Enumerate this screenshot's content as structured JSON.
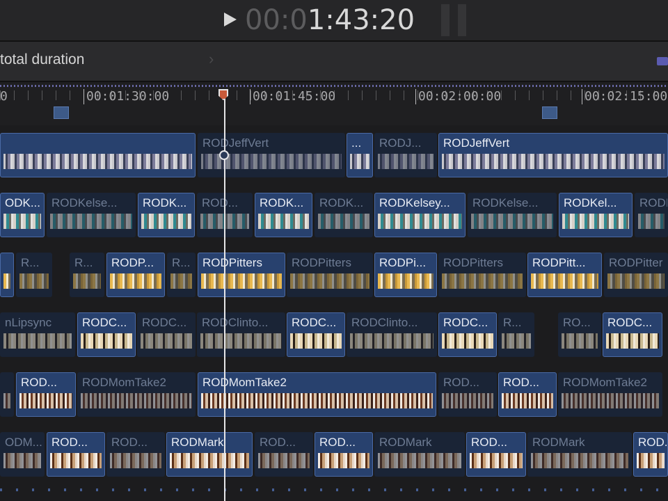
{
  "transport": {
    "timecode_dim": "00:0",
    "timecode_bright": "1:43:20",
    "play_icon": "play-icon"
  },
  "info": {
    "duration_label": "total duration",
    "chevron_icon": "chevron-right-icon"
  },
  "ruler": {
    "labels": [
      "0",
      "00:01:30:00",
      "00:01:45:00",
      "00:02:00:00",
      "00:02:15:00"
    ]
  },
  "tracks": [
    [
      {
        "name": "",
        "sel": true,
        "start": 0,
        "width": 281
      },
      {
        "name": "RODJeffVert",
        "sel": false,
        "start": 284,
        "width": 212
      },
      {
        "name": "...",
        "sel": true,
        "start": 498,
        "width": 38
      },
      {
        "name": "RODJ...",
        "sel": false,
        "start": 538,
        "width": 90
      },
      {
        "name": "RODJeffVert",
        "sel": true,
        "start": 630,
        "width": 330
      }
    ],
    [
      {
        "name": "ODK...",
        "sel": true,
        "start": 0,
        "width": 64
      },
      {
        "name": "RODKelse...",
        "sel": false,
        "start": 67,
        "width": 128
      },
      {
        "name": "RODK...",
        "sel": true,
        "start": 198,
        "width": 82
      },
      {
        "name": "ROD...",
        "sel": false,
        "start": 283,
        "width": 80
      },
      {
        "name": "RODK...",
        "sel": true,
        "start": 366,
        "width": 83
      },
      {
        "name": "RODK...",
        "sel": false,
        "start": 452,
        "width": 84
      },
      {
        "name": "RODKelsey...",
        "sel": true,
        "start": 538,
        "width": 131
      },
      {
        "name": "RODKelse...",
        "sel": false,
        "start": 672,
        "width": 128
      },
      {
        "name": "RODKel...",
        "sel": true,
        "start": 803,
        "width": 106
      },
      {
        "name": "RODI",
        "sel": false,
        "start": 912,
        "width": 48
      }
    ],
    [
      {
        "name": "",
        "sel": true,
        "start": 0,
        "width": 20
      },
      {
        "name": "R...",
        "sel": false,
        "start": 23,
        "width": 52
      },
      {
        "name": "R...",
        "sel": false,
        "start": 100,
        "width": 50
      },
      {
        "name": "RODP...",
        "sel": true,
        "start": 153,
        "width": 84
      },
      {
        "name": "R...",
        "sel": false,
        "start": 240,
        "width": 41
      },
      {
        "name": "RODPitters",
        "sel": true,
        "start": 284,
        "width": 126
      },
      {
        "name": "RODPitters",
        "sel": false,
        "start": 412,
        "width": 124
      },
      {
        "name": "RODPi...",
        "sel": true,
        "start": 538,
        "width": 90
      },
      {
        "name": "RODPitters",
        "sel": false,
        "start": 630,
        "width": 126
      },
      {
        "name": "RODPitt...",
        "sel": true,
        "start": 758,
        "width": 107
      },
      {
        "name": "RODPitter",
        "sel": false,
        "start": 868,
        "width": 92
      }
    ],
    [
      {
        "name": "nLipsync",
        "sel": false,
        "start": 0,
        "width": 108
      },
      {
        "name": "RODC...",
        "sel": true,
        "start": 111,
        "width": 84
      },
      {
        "name": "RODC...",
        "sel": false,
        "start": 197,
        "width": 84
      },
      {
        "name": "RODClinto...",
        "sel": false,
        "start": 283,
        "width": 127
      },
      {
        "name": "RODC...",
        "sel": true,
        "start": 412,
        "width": 84
      },
      {
        "name": "RODClinto...",
        "sel": false,
        "start": 498,
        "width": 130
      },
      {
        "name": "RODC...",
        "sel": true,
        "start": 630,
        "width": 84
      },
      {
        "name": "R...",
        "sel": false,
        "start": 716,
        "width": 52
      },
      {
        "name": "RO...",
        "sel": false,
        "start": 802,
        "width": 62
      },
      {
        "name": "RODC...",
        "sel": true,
        "start": 866,
        "width": 86
      }
    ],
    [
      {
        "name": "",
        "sel": false,
        "start": 0,
        "width": 20
      },
      {
        "name": "ROD...",
        "sel": true,
        "start": 23,
        "width": 86
      },
      {
        "name": "RODMomTake2",
        "sel": false,
        "start": 111,
        "width": 170
      },
      {
        "name": "RODMomTake2",
        "sel": true,
        "start": 284,
        "width": 343
      },
      {
        "name": "ROD...",
        "sel": false,
        "start": 630,
        "width": 84
      },
      {
        "name": "ROD...",
        "sel": true,
        "start": 716,
        "width": 84
      },
      {
        "name": "RODMomTake2",
        "sel": false,
        "start": 802,
        "width": 150
      }
    ],
    [
      {
        "name": "ODM...",
        "sel": false,
        "start": 0,
        "width": 64
      },
      {
        "name": "ROD...",
        "sel": true,
        "start": 67,
        "width": 84
      },
      {
        "name": "ROD...",
        "sel": false,
        "start": 153,
        "width": 84
      },
      {
        "name": "RODMark",
        "sel": true,
        "start": 239,
        "width": 124
      },
      {
        "name": "ROD...",
        "sel": false,
        "start": 366,
        "width": 84
      },
      {
        "name": "ROD...",
        "sel": true,
        "start": 452,
        "width": 84
      },
      {
        "name": "RODMark",
        "sel": false,
        "start": 538,
        "width": 130
      },
      {
        "name": "ROD...",
        "sel": true,
        "start": 670,
        "width": 86
      },
      {
        "name": "RODMark",
        "sel": false,
        "start": 758,
        "width": 150
      },
      {
        "name": "ROD...",
        "sel": true,
        "start": 910,
        "width": 50
      }
    ]
  ]
}
